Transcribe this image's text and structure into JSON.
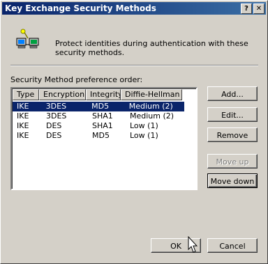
{
  "window": {
    "title": "Key Exchange Security Methods",
    "help_glyph": "?",
    "close_glyph": "✕"
  },
  "description": "Protect identities during authentication with these security methods.",
  "list_label": "Security Method preference order:",
  "columns": [
    "Type",
    "Encryption",
    "Integrity",
    "Diffie-Hellman ..."
  ],
  "rows": [
    {
      "type": "IKE",
      "encryption": "3DES",
      "integrity": "MD5",
      "dh": "Medium (2)",
      "selected": true
    },
    {
      "type": "IKE",
      "encryption": "3DES",
      "integrity": "SHA1",
      "dh": "Medium (2)",
      "selected": false
    },
    {
      "type": "IKE",
      "encryption": "DES",
      "integrity": "SHA1",
      "dh": "Low (1)",
      "selected": false
    },
    {
      "type": "IKE",
      "encryption": "DES",
      "integrity": "MD5",
      "dh": "Low (1)",
      "selected": false
    }
  ],
  "buttons": {
    "add": "Add...",
    "edit": "Edit...",
    "remove": "Remove",
    "move_up": "Move up",
    "move_down": "Move down",
    "ok": "OK",
    "cancel": "Cancel"
  },
  "colors": {
    "title_bar": "#0a246a",
    "selection": "#0a246a",
    "face": "#d4d0c8"
  },
  "icons": [
    "network-key-icon",
    "help-icon",
    "close-icon",
    "mouse-cursor-icon"
  ]
}
